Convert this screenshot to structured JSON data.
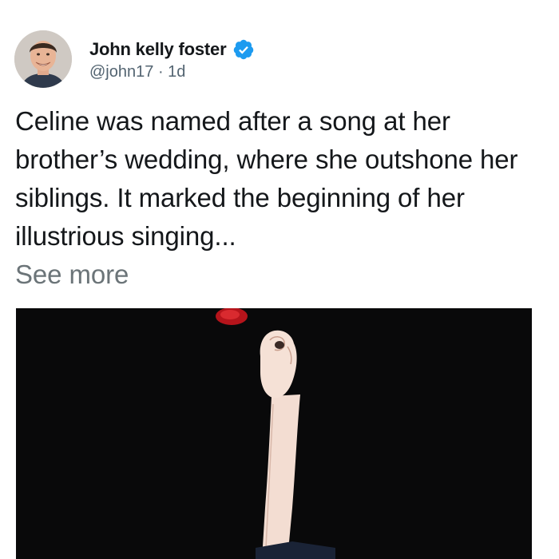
{
  "tweet": {
    "author_name": "John kelly foster",
    "handle": "@john17",
    "separator": "·",
    "time_ago": "1d",
    "verified": true,
    "text": "Celine was named after a song at her brother’s wedding, where she outshone her siblings. It marked the beginning of her illustrious singing...",
    "see_more_label": "See more"
  },
  "icons": {
    "verified": "verified-badge-icon",
    "avatar": "profile-photo"
  },
  "colors": {
    "accent": "#1d9bf0",
    "text": "#14171a",
    "muted": "#536471",
    "media_bg": "#050505"
  }
}
